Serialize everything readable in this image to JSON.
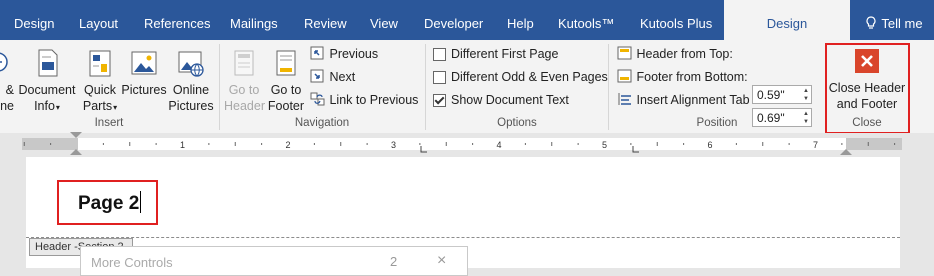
{
  "tabs": [
    {
      "label": "Design",
      "active": false
    },
    {
      "label": "Layout",
      "active": false
    },
    {
      "label": "References",
      "active": false
    },
    {
      "label": "Mailings",
      "active": false
    },
    {
      "label": "Review",
      "active": false
    },
    {
      "label": "View",
      "active": false
    },
    {
      "label": "Developer",
      "active": false
    },
    {
      "label": "Help",
      "active": false
    },
    {
      "label": "Kutools™",
      "active": false
    },
    {
      "label": "Kutools Plus",
      "active": false
    },
    {
      "label": "Design",
      "active": true
    }
  ],
  "tell_me": "Tell me",
  "insert_group": {
    "label": "Insert",
    "date_time_partial": "& \nne",
    "document_info": "Document\nInfo",
    "quick_parts": "Quick\nParts",
    "pictures": "Pictures",
    "online_pictures": "Online\nPictures"
  },
  "navigation_group": {
    "label": "Navigation",
    "go_to_header": "Go to\nHeader",
    "go_to_footer": "Go to\nFooter",
    "previous": "Previous",
    "next": "Next",
    "link_to_previous": "Link to Previous"
  },
  "options_group": {
    "label": "Options",
    "different_first_page": {
      "label": "Different First Page",
      "checked": false
    },
    "different_odd_even": {
      "label": "Different Odd & Even Pages",
      "checked": false
    },
    "show_document_text": {
      "label": "Show Document Text",
      "checked": true
    }
  },
  "position_group": {
    "label": "Position",
    "header_from_top": {
      "label": "Header from Top:",
      "value": "0.59\""
    },
    "footer_from_bottom": {
      "label": "Footer from Bottom:",
      "value": "0.69\""
    },
    "insert_alignment_tab": "Insert Alignment Tab"
  },
  "close_group": {
    "label": "Close",
    "button": "Close Header\nand Footer"
  },
  "ruler_numbers": [
    "1",
    "2",
    "3",
    "4",
    "5",
    "6",
    "7"
  ],
  "document": {
    "header_text": "Page 2",
    "header_tag": "Header -Section 2-",
    "popup_text": "More Controls",
    "popup_number": "2",
    "popup_close": "×"
  },
  "colors": {
    "accent": "#2b579a",
    "highlight": "#e02020",
    "close_icon": "#d9452b"
  }
}
